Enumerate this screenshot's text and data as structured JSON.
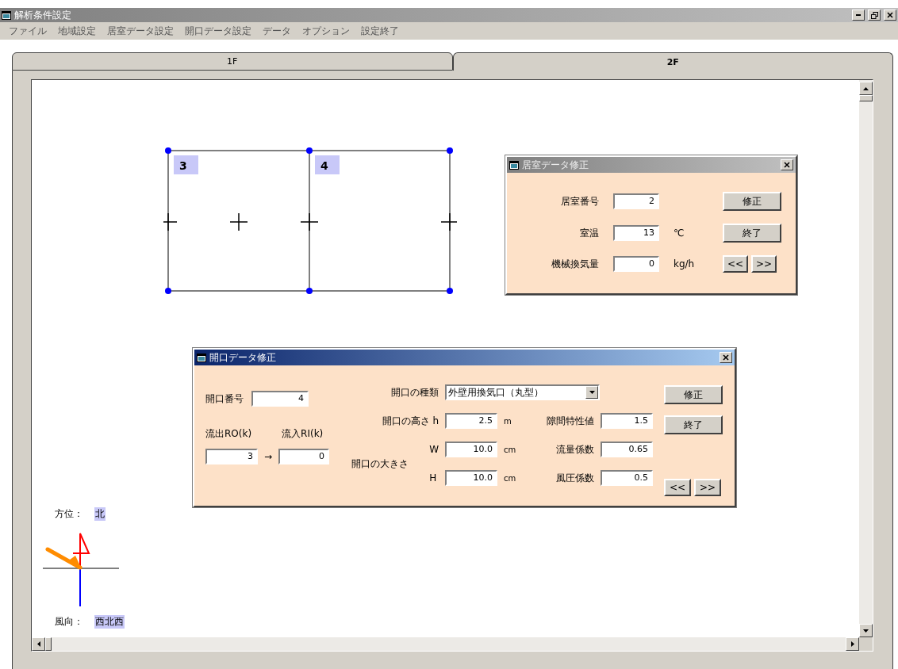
{
  "window": {
    "title": "解析条件設定"
  },
  "menu": [
    "ファイル",
    "地域設定",
    "居室データ設定",
    "開口データ設定",
    "データ",
    "オプション",
    "設定終了"
  ],
  "tabs": [
    {
      "label": "1F",
      "selected": false
    },
    {
      "label": "2F",
      "selected": true
    }
  ],
  "plan": {
    "rooms": [
      {
        "label": "3"
      },
      {
        "label": "4"
      }
    ]
  },
  "compass": {
    "direction_label": "方位：",
    "direction": "北",
    "wind_label": "風向：",
    "wind": "西北西"
  },
  "room_dialog": {
    "title": "居室データ修正",
    "active": false,
    "fields": [
      {
        "label": "居室番号",
        "value": "2"
      },
      {
        "label": "室温",
        "value": "13",
        "unit": "℃"
      },
      {
        "label": "機械換気量",
        "value": "0",
        "unit": "kg/h"
      }
    ],
    "buttons": [
      "修正",
      "終了"
    ],
    "nav": [
      "<<",
      ">>"
    ]
  },
  "opening_dialog": {
    "title": "開口データ修正",
    "active": true,
    "number": {
      "label": "開口番号",
      "value": "4"
    },
    "outflow": {
      "label": "流出RO(k)",
      "value": "3"
    },
    "arrow": "→",
    "inflow": {
      "label": "流入RI(k)",
      "value": "0"
    },
    "type": {
      "label": "開口の種類",
      "value": "外壁用換気口（丸型）"
    },
    "height": {
      "label": "開口の高さ h",
      "value": "2.5",
      "unit": "m"
    },
    "size_label": "開口の大きさ",
    "size": [
      {
        "label": "W",
        "value": "10.0",
        "unit": "cm"
      },
      {
        "label": "H",
        "value": "10.0",
        "unit": "cm"
      }
    ],
    "coefficients": [
      {
        "label": "隙間特性値",
        "value": "1.5"
      },
      {
        "label": "流量係数",
        "value": "0.65"
      },
      {
        "label": "風圧係数",
        "value": "0.5"
      }
    ],
    "buttons": [
      "修正",
      "終了"
    ],
    "nav": [
      "<<",
      ">>"
    ]
  }
}
